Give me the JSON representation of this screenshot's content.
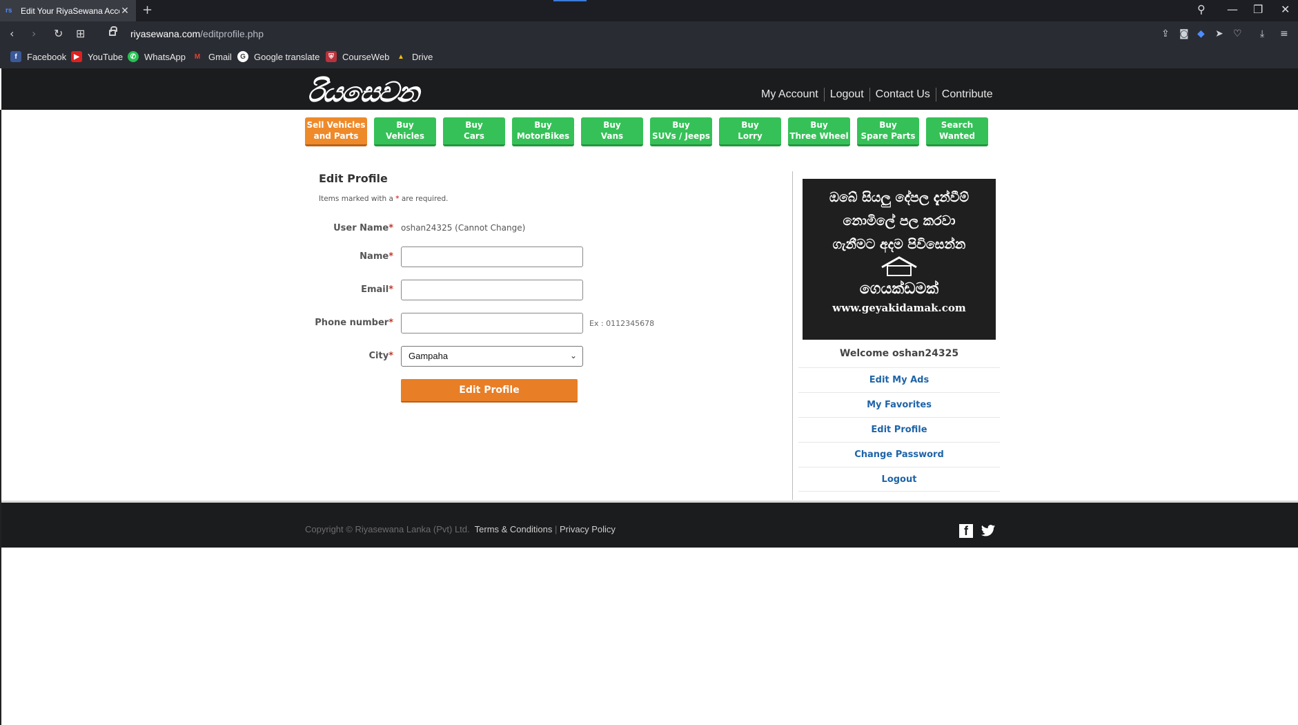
{
  "browser": {
    "tab_title": "Edit Your RiyaSewana Acco",
    "url_host": "riyasewana.com",
    "url_path": "/editprofile.php",
    "bookmarks": [
      "Facebook",
      "YouTube",
      "WhatsApp",
      "Gmail",
      "Google translate",
      "CourseWeb",
      "Drive"
    ]
  },
  "site": {
    "logo": "රියසෙවන",
    "top_links": [
      "My Account",
      "Logout",
      "Contact Us",
      "Contribute"
    ],
    "categories": [
      {
        "l1": "Sell Vehicles",
        "l2": "and Parts"
      },
      {
        "l1": "Buy",
        "l2": "Vehicles"
      },
      {
        "l1": "Buy",
        "l2": "Cars"
      },
      {
        "l1": "Buy",
        "l2": "MotorBikes"
      },
      {
        "l1": "Buy",
        "l2": "Vans"
      },
      {
        "l1": "Buy",
        "l2": "SUVs / Jeeps"
      },
      {
        "l1": "Buy",
        "l2": "Lorry"
      },
      {
        "l1": "Buy",
        "l2": "Three Wheel"
      },
      {
        "l1": "Buy",
        "l2": "Spare Parts"
      },
      {
        "l1": "Search",
        "l2": "Wanted"
      }
    ]
  },
  "form": {
    "title": "Edit Profile",
    "note_prefix": "Items marked with a ",
    "note_star": "*",
    "note_suffix": " are required.",
    "username_label": "User Name",
    "username_value": "oshan24325 (Cannot Change)",
    "name_label": "Name",
    "name_value": "",
    "email_label": "Email",
    "email_value": "",
    "phone_label": "Phone number",
    "phone_value": "",
    "phone_hint": "Ex : 0112345678",
    "city_label": "City",
    "city_value": "Gampaha",
    "required_mark": "*",
    "submit_label": "Edit Profile"
  },
  "ad": {
    "line1": "ඔබේ සියලු දේපල දැන්වීම්",
    "line2": "නොමිලේ පල කරවා",
    "line3": "ගැනීමට අදම පිවිසෙන්න",
    "brand": "ගෙයක්ඩමක්",
    "site": "www.geyakidamak.com"
  },
  "sidebar": {
    "welcome": "Welcome oshan24325",
    "links": [
      "Edit My Ads",
      "My Favorites",
      "Edit Profile",
      "Change Password",
      "Logout"
    ]
  },
  "footer": {
    "copyright": "Copyright © Riyasewana Lanka (Pvt) Ltd.",
    "terms": "Terms & Conditions",
    "separator": "|",
    "privacy": "Privacy Policy"
  },
  "colors": {
    "header_bg": "#1b1c1e",
    "cat_green": "#35c157",
    "cat_orange": "#ee8a2a",
    "submit_orange": "#e87e26",
    "link_blue": "#1e64a8"
  }
}
